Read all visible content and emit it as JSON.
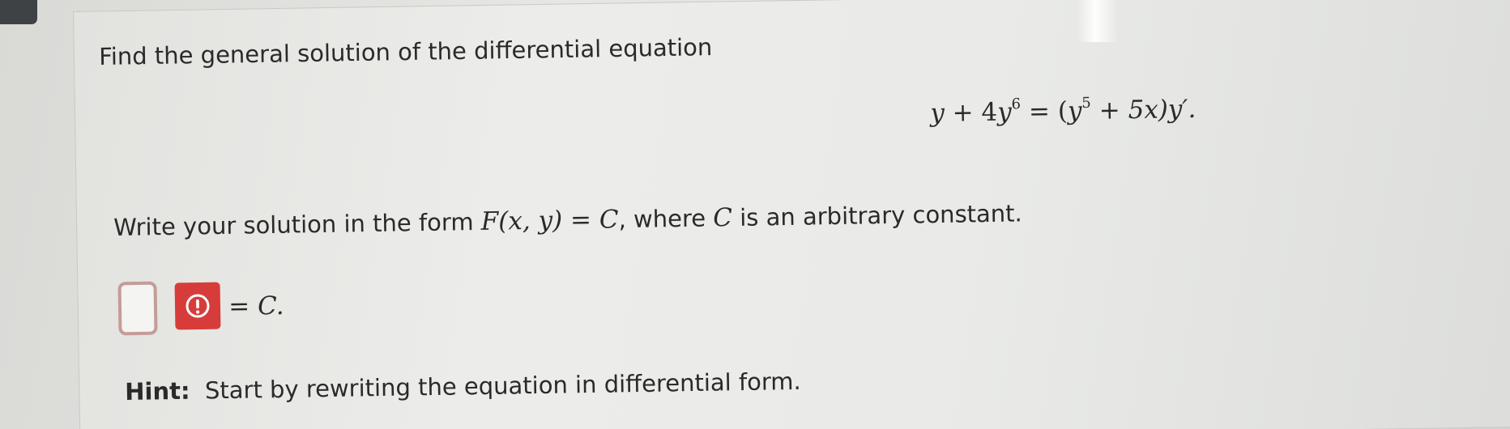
{
  "question": {
    "prompt": "Find the general solution of the differential equation",
    "equation": {
      "lhs_y": "y",
      "lhs_plus": " + 4",
      "lhs_y2": "y",
      "lhs_exp": "6",
      "equals": " = (",
      "rhs_y": "y",
      "rhs_exp": "5",
      "rhs_rest": " + 5x)y′."
    },
    "instruction": {
      "part1": "Write your solution in the form ",
      "math1": "F(x, y) = C",
      "part2": ", where ",
      "math2": "C",
      "part3": " is an arbitrary constant."
    },
    "answer": {
      "value": "",
      "suffix": "= C."
    },
    "hint": {
      "label": "Hint:",
      "text": "Start by rewriting the equation in differential form."
    }
  },
  "colors": {
    "error_badge": "#d63d3a",
    "input_border": "#c49c98"
  },
  "icons": {
    "error": "exclamation-circle-icon"
  }
}
